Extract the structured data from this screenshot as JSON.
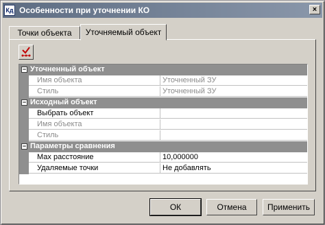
{
  "window": {
    "title": "Особенности при уточнении КО",
    "icon_text": "Кд",
    "close_glyph": "×"
  },
  "tabs": [
    {
      "label": "Точки объекта"
    },
    {
      "label": "Уточняемый объект",
      "active": true
    }
  ],
  "toolbar": {
    "tool_icon": "checkmark-points-icon"
  },
  "sections": [
    {
      "title": "Уточненный объект",
      "collapse_glyph": "−",
      "rows": [
        {
          "name": "Имя объекта",
          "value": "Уточненный ЗУ",
          "disabled": true
        },
        {
          "name": "Стиль",
          "value": "Уточненный ЗУ",
          "disabled": true
        }
      ]
    },
    {
      "title": "Исходный объект",
      "collapse_glyph": "−",
      "rows": [
        {
          "name": "Выбрать объект",
          "value": "",
          "disabled": false
        },
        {
          "name": "Имя объекта",
          "value": "",
          "disabled": true
        },
        {
          "name": "Стиль",
          "value": "",
          "disabled": true
        }
      ]
    },
    {
      "title": "Параметры сравнения",
      "collapse_glyph": "−",
      "rows": [
        {
          "name": "Мах расстояние",
          "value": "10,000000",
          "disabled": false
        },
        {
          "name": "Удаляемые точки",
          "value": "Не добавлять",
          "disabled": false
        }
      ]
    }
  ],
  "buttons": {
    "ok": "ОК",
    "cancel": "Отмена",
    "apply": "Применить"
  },
  "colors": {
    "section_header": "#8f8f8f",
    "title_bar_start": "#5d6c82",
    "title_bar_end": "#8a97aa",
    "face": "#d4d0c8"
  }
}
